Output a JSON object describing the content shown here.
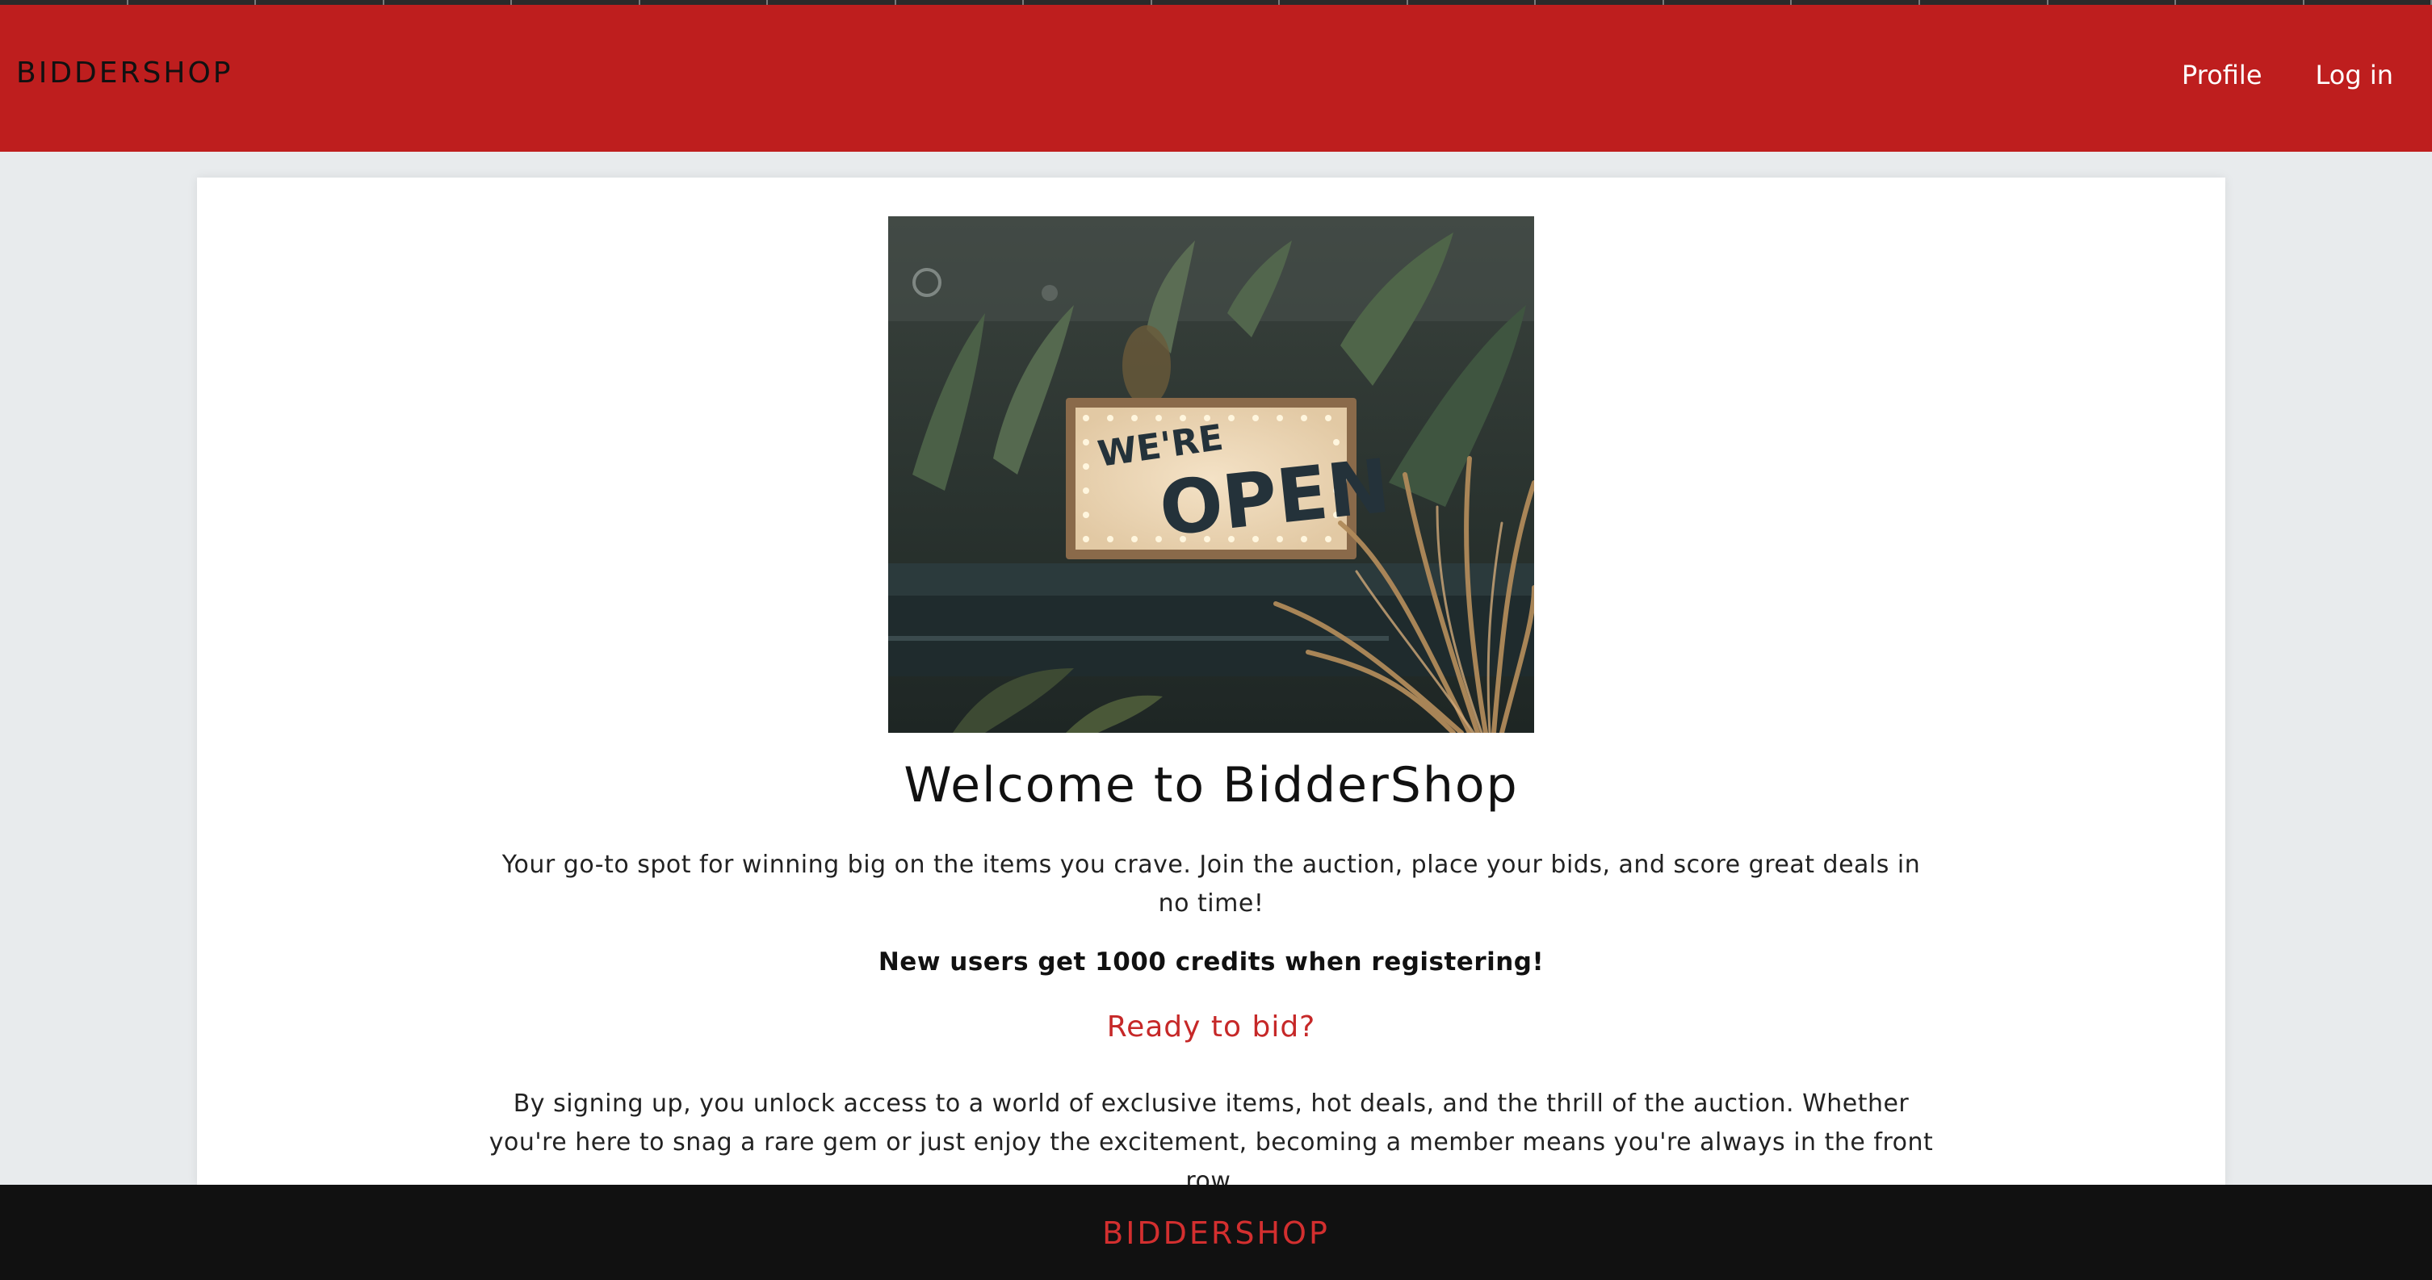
{
  "header": {
    "brand": "BIDDERSHOP",
    "nav": {
      "profile": "Profile",
      "login": "Log in"
    }
  },
  "hero": {
    "image_alt": "Storefront window sign reading WE'RE OPEN among plants",
    "sign_line1": "WE'RE",
    "sign_line2": "OPEN"
  },
  "main": {
    "title": "Welcome to BidderShop",
    "intro": "Your go-to spot for winning big on the items you crave. Join the auction, place your bids, and score great deals in no time!",
    "credits": "New users get 1000 credits when registering!",
    "cta": "Ready to bid?",
    "signup_text": "By signing up, you unlock access to a world of exclusive items, hot deals, and the thrill of the auction. Whether you're here to snag a rare gem or just enjoy the excitement, becoming a member means you're always in the front row."
  },
  "footer": {
    "brand": "BIDDERSHOP"
  },
  "colors": {
    "header_bg": "#be1e1e",
    "accent_red": "#c62828",
    "footer_bg": "#111111",
    "page_bg": "#e8ebed"
  }
}
